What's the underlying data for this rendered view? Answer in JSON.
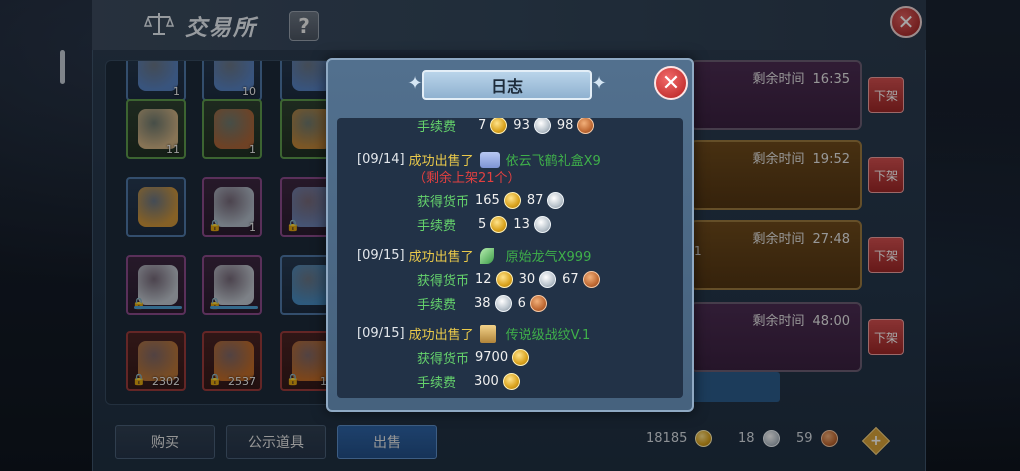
{
  "window": {
    "title": "交易所",
    "help_label": "?",
    "close_label": "✕"
  },
  "inventory": {
    "slots": [
      {
        "qty": "1",
        "rarity": "blue",
        "icon": "gem-icon"
      },
      {
        "qty": "10",
        "rarity": "blue",
        "icon": "gem-icon"
      },
      {
        "qty": "",
        "rarity": "blue",
        "icon": "gem-icon"
      },
      {
        "qty": "11",
        "rarity": "green",
        "icon": "scroll-icon"
      },
      {
        "qty": "1",
        "rarity": "green",
        "icon": "drumstick-icon"
      },
      {
        "qty": "",
        "rarity": "green",
        "icon": "bag-icon"
      },
      {
        "qty": "",
        "rarity": "blue",
        "icon": "bow-icon"
      },
      {
        "qty": "1",
        "rarity": "purple",
        "icon": "axe-icon"
      },
      {
        "qty": "",
        "rarity": "purple",
        "icon": "armor-icon"
      },
      {
        "qty": "",
        "rarity": "purple",
        "icon": "spear-icon"
      },
      {
        "qty": "",
        "rarity": "purple",
        "icon": "spear-icon"
      },
      {
        "qty": "",
        "rarity": "blue",
        "icon": "mount-icon"
      },
      {
        "qty": "2302",
        "rarity": "red",
        "icon": "bread-icon"
      },
      {
        "qty": "2537",
        "rarity": "red",
        "icon": "coin-icon"
      },
      {
        "qty": "14",
        "rarity": "red",
        "icon": "coin-icon"
      }
    ]
  },
  "listings": [
    {
      "remain_label": "剩余时间",
      "time": "16:35",
      "delist_label": "下架",
      "color": "purple",
      "extra": ""
    },
    {
      "remain_label": "剩余时间",
      "time": "19:52",
      "delist_label": "下架",
      "color": "orange",
      "extra": ""
    },
    {
      "remain_label": "剩余时间",
      "time": "27:48",
      "delist_label": "下架",
      "color": "orange",
      "extra": "1"
    },
    {
      "remain_label": "剩余时间",
      "time": "48:00",
      "delist_label": "下架",
      "color": "purple",
      "extra": ""
    }
  ],
  "tabs": {
    "buy": "购买",
    "showcase": "公示道具",
    "sell": "出售"
  },
  "currency": {
    "gold": "18185",
    "silver": "18",
    "bronze": "59",
    "add_label": "+"
  },
  "log": {
    "title": "日志",
    "close_label": "✕",
    "top_fee": {
      "label": "手续费",
      "gold": "7",
      "silver": "93",
      "bronze": "98"
    },
    "entries": [
      {
        "date": "[09/14]",
        "sold": "成功出售了",
        "item": "依云飞鹤礼盒X9",
        "remain": "（剩余上架21个）",
        "earned_label": "获得货币",
        "earned": {
          "gold": "165",
          "silver": "87"
        },
        "fee_label": "手续费",
        "fee": {
          "gold": "5",
          "silver": "13"
        }
      },
      {
        "date": "[09/15]",
        "sold": "成功出售了",
        "item": "原始龙气X999",
        "earned_label": "获得货币",
        "earned": {
          "gold": "12",
          "silver": "30",
          "bronze": "67"
        },
        "fee_label": "手续费",
        "fee": {
          "silver": "38",
          "bronze": "6"
        }
      },
      {
        "date": "[09/15]",
        "sold": "成功出售了",
        "item": "传说级战纹V.1",
        "earned_label": "获得货币",
        "earned": {
          "gold": "9700"
        },
        "fee_label": "手续费",
        "fee": {
          "gold": "300"
        }
      }
    ]
  },
  "colors": {
    "accent_gold": "#e9c94a",
    "item_green": "#3fb04a",
    "warning_red": "#e24040",
    "panel_blue": "#52708e"
  }
}
